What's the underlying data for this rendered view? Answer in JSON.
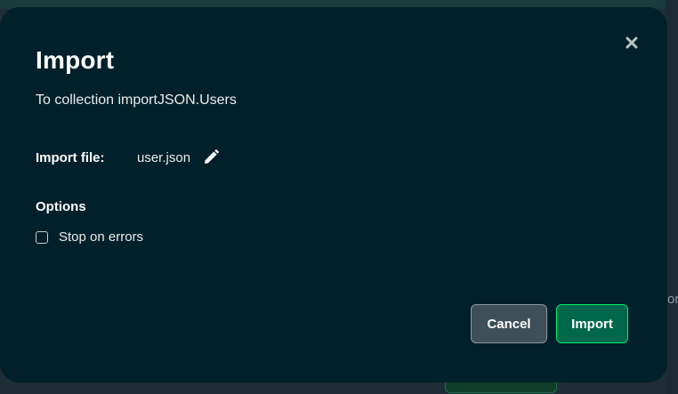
{
  "backdrop": {
    "tail_text": "or"
  },
  "modal": {
    "title": "Import",
    "subtitle": "To collection importJSON.Users",
    "import_file_label": "Import file:",
    "import_file_name": "user.json",
    "options_heading": "Options",
    "stop_on_errors_label": "Stop on errors",
    "stop_on_errors_checked": false,
    "cancel_label": "Cancel",
    "import_label": "Import",
    "close_icon": "close-icon",
    "edit_icon": "pencil-icon"
  },
  "colors": {
    "modal_bg": "#00202b",
    "primary_button": "#00684a",
    "primary_button_border": "#00ed64",
    "secondary_button": "#3d4f58"
  }
}
